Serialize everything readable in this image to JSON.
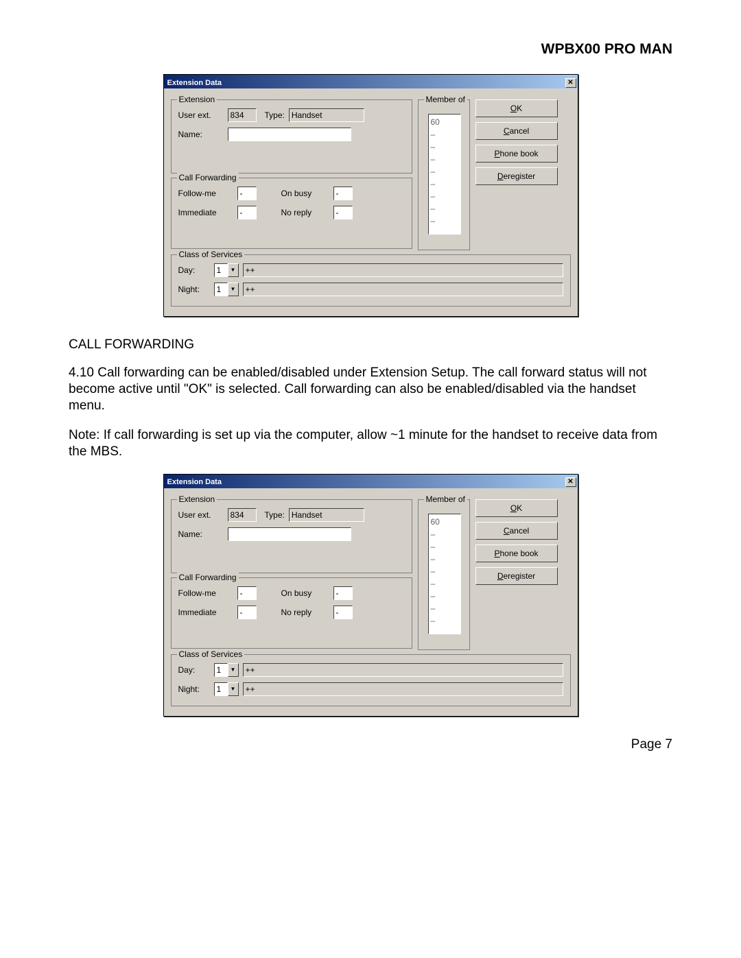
{
  "header": {
    "title": "WPBX00 PRO MAN"
  },
  "dialog": {
    "title": "Extension Data",
    "extension": {
      "legend": "Extension",
      "user_ext_label": "User ext.",
      "user_ext_value": "834",
      "type_label": "Type:",
      "type_value": "Handset",
      "name_label": "Name:",
      "name_value": ""
    },
    "member": {
      "legend": "Member of",
      "items": [
        "60",
        "–",
        "–",
        "–",
        "–",
        "–",
        "–",
        "–",
        "–"
      ]
    },
    "buttons": {
      "ok": "OK",
      "cancel": "Cancel",
      "phonebook": "Phone book",
      "deregister": "Deregister"
    },
    "cf": {
      "legend": "Call Forwarding",
      "follow_label": "Follow-me",
      "follow_value": "-",
      "onbusy_label": "On busy",
      "onbusy_value": "-",
      "immediate_label": "Immediate",
      "immediate_value": "-",
      "noreply_label": "No reply",
      "noreply_value": "-"
    },
    "cos": {
      "legend": "Class of Services",
      "day_label": "Day:",
      "day_value": "1",
      "day_text": "++",
      "night_label": "Night:",
      "night_value": "1",
      "night_text": "++"
    }
  },
  "doc": {
    "section_heading": "CALL FORWARDING",
    "para1": "4.10    Call forwarding can be enabled/disabled under Extension Setup.  The call forward status will not become active until \"OK\" is selected.  Call forwarding can also be enabled/disabled via the handset menu.",
    "para2": "Note:  If call forwarding is set up via the computer, allow ~1 minute for the handset to receive data from the MBS."
  },
  "footer": {
    "page": "Page 7"
  }
}
